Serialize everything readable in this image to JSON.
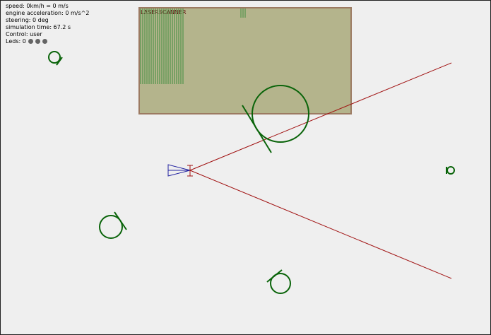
{
  "hud": {
    "speed": "speed: 0km/h = 0 m/s",
    "acceleration": "engine acceleration: 0 m/s^2",
    "steering": "steering: 0 deg",
    "sim_time": "simulation time: 67.2 s",
    "control": "Control: user",
    "leds": "Leds: 0",
    "led_color": "#646464"
  },
  "laserscanner": {
    "label": "LASERSCANNER",
    "panel_color": "#b4b48c",
    "border_color": "#9c7a62",
    "hit_color": "#3c8c3c"
  },
  "colors": {
    "background": "#efefef",
    "obstacle": "#0a640a",
    "ray": "#a01010",
    "car": "#2323a0"
  }
}
